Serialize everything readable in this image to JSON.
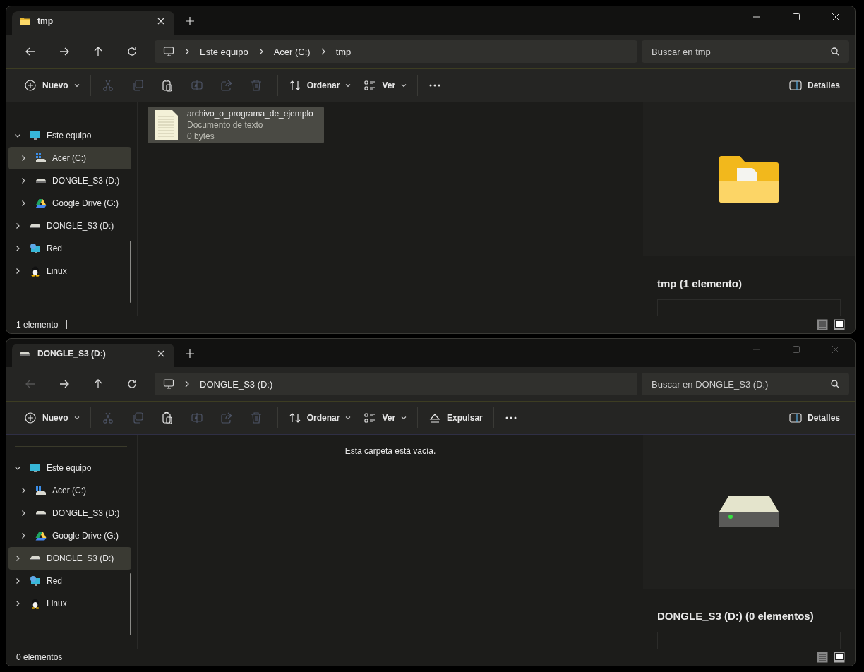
{
  "windows": [
    {
      "active": true,
      "tab": {
        "label": "tmp",
        "kind": "folder",
        "selected": true
      },
      "nav": [
        {
          "kind": "back",
          "disabled": false
        },
        {
          "kind": "forward",
          "disabled": false
        },
        {
          "kind": "up",
          "disabled": false
        },
        {
          "kind": "refresh",
          "disabled": false
        }
      ],
      "breadcrumb": [
        "Este equipo",
        "Acer (C:)",
        "tmp"
      ],
      "search": {
        "placeholder": "Buscar en tmp"
      },
      "toolbar": [
        {
          "kind": "new",
          "label": "Nuevo",
          "dropdown": true,
          "disabled": false
        },
        {
          "kind": "cut",
          "disabled": true
        },
        {
          "kind": "copy",
          "disabled": true
        },
        {
          "kind": "paste",
          "disabled": false
        },
        {
          "kind": "rename",
          "disabled": true
        },
        {
          "kind": "share",
          "disabled": true
        },
        {
          "kind": "delete",
          "disabled": true
        },
        {
          "kind": "sort",
          "label": "Ordenar",
          "dropdown": true,
          "disabled": false
        },
        {
          "kind": "view",
          "label": "Ver",
          "dropdown": true,
          "disabled": false
        },
        {
          "kind": "more",
          "disabled": false
        }
      ],
      "details_button": {
        "label": "Detalles"
      },
      "sidebar": [
        {
          "label": "Este equipo",
          "kind": "pc",
          "expanded": true,
          "selected": false,
          "children": [
            {
              "label": "Acer (C:)",
              "kind": "system-drive",
              "expanded": false,
              "selected": true
            },
            {
              "label": "DONGLE_S3 (D:)",
              "kind": "usb-drive",
              "expanded": false,
              "selected": false
            },
            {
              "label": "Google Drive (G:)",
              "kind": "cloud-drive",
              "expanded": false,
              "selected": false
            }
          ]
        },
        {
          "label": "DONGLE_S3 (D:)",
          "kind": "usb-drive",
          "expanded": false,
          "selected": false
        },
        {
          "label": "Red",
          "kind": "network",
          "expanded": false,
          "selected": false
        },
        {
          "label": "Linux",
          "kind": "linux",
          "expanded": false,
          "selected": false
        }
      ],
      "files": [
        {
          "name": "archivo_o_programa_de_ejemplo",
          "type": "Documento de texto",
          "size": "0 bytes",
          "selected": true
        }
      ],
      "details": {
        "kind": "folder",
        "title": "tmp (1 elemento)"
      },
      "status": "1 elemento"
    },
    {
      "active": false,
      "tab": {
        "label": "DONGLE_S3 (D:)",
        "kind": "usb-drive",
        "selected": true
      },
      "nav": [
        {
          "kind": "back",
          "disabled": true
        },
        {
          "kind": "forward",
          "disabled": false
        },
        {
          "kind": "up",
          "disabled": false
        },
        {
          "kind": "refresh",
          "disabled": false
        }
      ],
      "breadcrumb": [
        "DONGLE_S3 (D:)"
      ],
      "search": {
        "placeholder": "Buscar en DONGLE_S3 (D:)"
      },
      "toolbar": [
        {
          "kind": "new",
          "label": "Nuevo",
          "dropdown": true,
          "disabled": false
        },
        {
          "kind": "cut",
          "disabled": true
        },
        {
          "kind": "copy",
          "disabled": true
        },
        {
          "kind": "paste",
          "disabled": false
        },
        {
          "kind": "rename",
          "disabled": true
        },
        {
          "kind": "share",
          "disabled": true
        },
        {
          "kind": "delete",
          "disabled": true
        },
        {
          "kind": "sort",
          "label": "Ordenar",
          "dropdown": true,
          "disabled": false
        },
        {
          "kind": "view",
          "label": "Ver",
          "dropdown": true,
          "disabled": false
        },
        {
          "kind": "eject",
          "label": "Expulsar",
          "dropdown": false,
          "disabled": false
        },
        {
          "kind": "more",
          "disabled": false
        }
      ],
      "details_button": {
        "label": "Detalles"
      },
      "sidebar": [
        {
          "label": "Este equipo",
          "kind": "pc",
          "expanded": true,
          "selected": false,
          "children": [
            {
              "label": "Acer (C:)",
              "kind": "system-drive",
              "expanded": false,
              "selected": false
            },
            {
              "label": "DONGLE_S3 (D:)",
              "kind": "usb-drive",
              "expanded": false,
              "selected": false
            },
            {
              "label": "Google Drive (G:)",
              "kind": "cloud-drive",
              "expanded": false,
              "selected": false
            }
          ]
        },
        {
          "label": "DONGLE_S3 (D:)",
          "kind": "usb-drive",
          "expanded": false,
          "selected": true
        },
        {
          "label": "Red",
          "kind": "network",
          "expanded": false,
          "selected": false
        },
        {
          "label": "Linux",
          "kind": "linux",
          "expanded": false,
          "selected": false
        }
      ],
      "empty_message": "Esta carpeta está vacía.",
      "details": {
        "kind": "usb-drive",
        "title": "DONGLE_S3 (D:) (0 elementos)"
      },
      "status": "0 elementos"
    }
  ]
}
